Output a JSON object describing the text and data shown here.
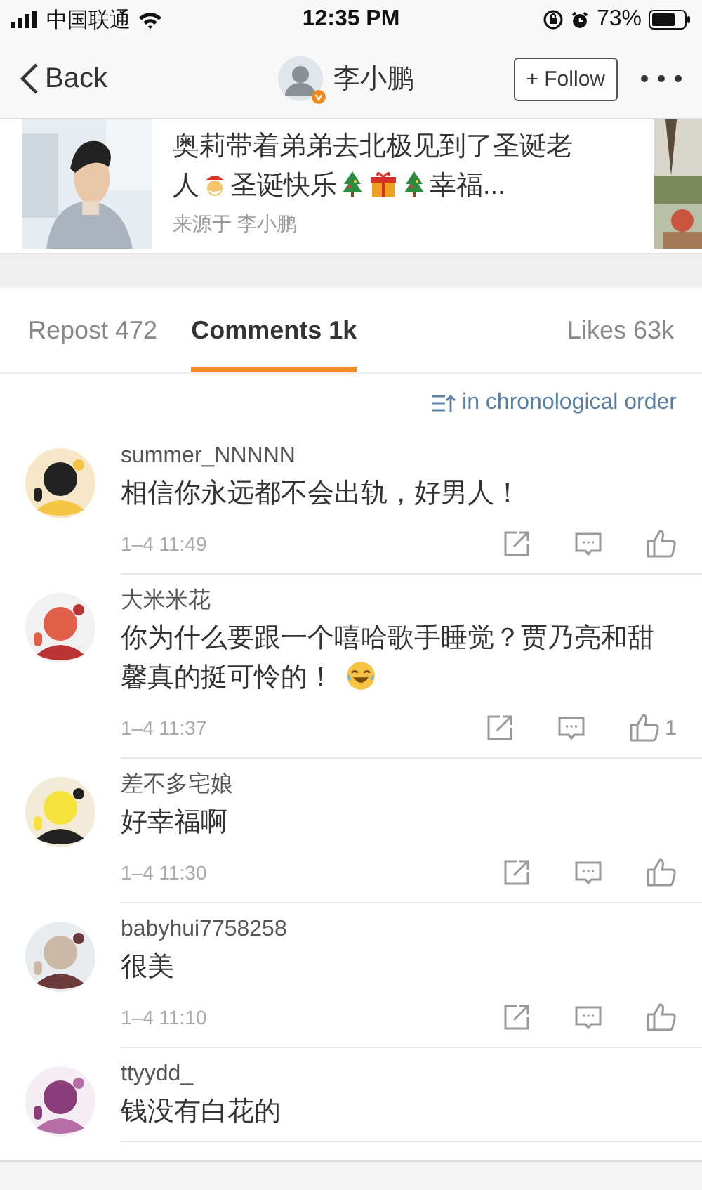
{
  "status_bar": {
    "carrier": "中国联通",
    "time": "12:35 PM",
    "battery": "73%"
  },
  "nav": {
    "back": "Back",
    "user": "李小鹏",
    "verified": true,
    "follow": "+ Follow"
  },
  "post": {
    "title": [
      {
        "kind": "text",
        "text": "奥莉带着弟弟去北极见到了圣诞老人"
      },
      {
        "kind": "santa"
      },
      {
        "kind": "text",
        "text": "圣诞快乐"
      },
      {
        "kind": "tree"
      },
      {
        "kind": "gift"
      },
      {
        "kind": "tree"
      },
      {
        "kind": "text",
        "text": "幸福..."
      }
    ],
    "source": "来源于 李小鹏"
  },
  "tabs": [
    {
      "label": "Repost 472",
      "selected": false
    },
    {
      "label": "Comments 1k",
      "selected": true
    },
    {
      "label": "Likes 63k",
      "selected": false
    }
  ],
  "sort": {
    "label": "in chronological order"
  },
  "comments": [
    {
      "user": "summer_NNNNN",
      "text": [
        {
          "kind": "text",
          "text": "相信你永远都不会出轨，好男人！"
        }
      ],
      "time": "1–4 11:49"
    },
    {
      "user": "大米米花",
      "text": [
        {
          "kind": "text",
          "text": "你为什么要跟一个嘻哈歌手睡觉？贾乃亮和甜馨真的挺可怜的！"
        },
        {
          "kind": "laugh"
        }
      ],
      "time": "1–4 11:37",
      "likes": "1"
    },
    {
      "user": "差不多宅娘",
      "text": [
        {
          "kind": "text",
          "text": "好幸福啊"
        }
      ],
      "time": "1–4 11:30"
    },
    {
      "user": "babyhui7758258",
      "text": [
        {
          "kind": "text",
          "text": "很美"
        }
      ],
      "time": "1–4 11:10"
    },
    {
      "user": "ttyydd_",
      "text": [
        {
          "kind": "text",
          "text": "钱没有白花的"
        }
      ]
    }
  ]
}
